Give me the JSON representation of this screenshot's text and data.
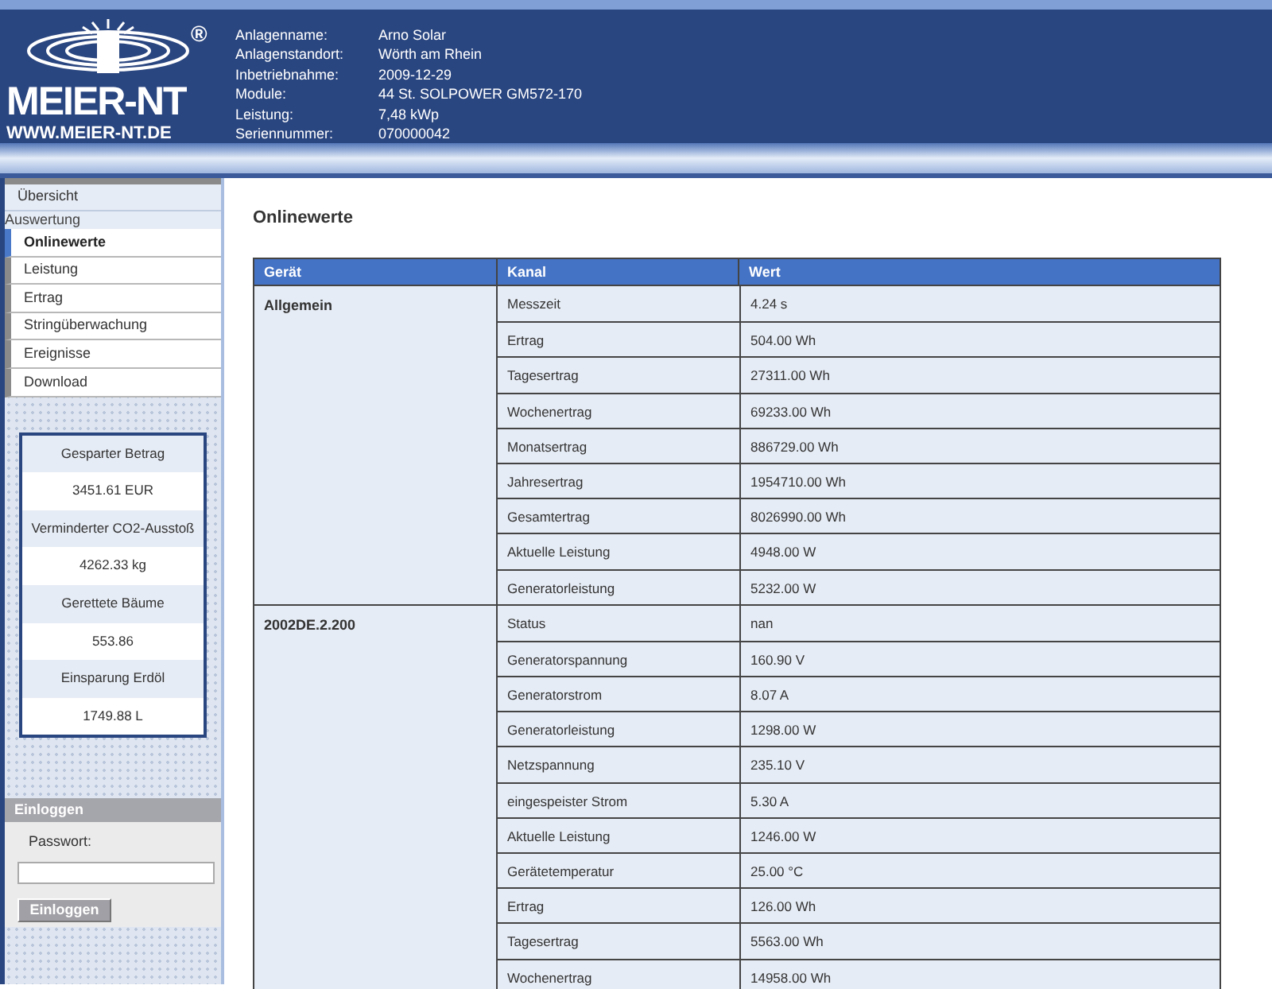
{
  "logo": {
    "wordmark": "MEIER-NT",
    "url": "WWW.MEIER-NT.DE",
    "registered": "®"
  },
  "plant_info": [
    {
      "label": "Anlagenname:",
      "value": "Arno Solar"
    },
    {
      "label": "Anlagenstandort:",
      "value": "Wörth am Rhein"
    },
    {
      "label": "Inbetriebnahme:",
      "value": "2009-12-29"
    },
    {
      "label": "Module:",
      "value": "44 St. SOLPOWER GM572-170"
    },
    {
      "label": "Leistung:",
      "value": "7,48 kWp"
    },
    {
      "label": "Seriennummer:",
      "value": "070000042"
    }
  ],
  "sidebar": {
    "top_item": {
      "label": "Übersicht",
      "selected": false
    },
    "section_label": "Auswertung",
    "items": [
      {
        "label": "Onlinewerte",
        "selected": true
      },
      {
        "label": "Leistung",
        "selected": false
      },
      {
        "label": "Ertrag",
        "selected": false
      },
      {
        "label": "Stringüberwachung",
        "selected": false
      },
      {
        "label": "Ereignisse",
        "selected": false
      },
      {
        "label": "Download",
        "selected": false
      }
    ]
  },
  "savings": [
    {
      "kind": "label",
      "text": "Gesparter Betrag"
    },
    {
      "kind": "value",
      "text": "3451.61 EUR"
    },
    {
      "kind": "label",
      "text": "Verminderter CO2-Ausstoß"
    },
    {
      "kind": "value",
      "text": "4262.33 kg"
    },
    {
      "kind": "label",
      "text": "Gerettete Bäume"
    },
    {
      "kind": "value",
      "text": "553.86"
    },
    {
      "kind": "label",
      "text": "Einsparung Erdöl"
    },
    {
      "kind": "value",
      "text": "1749.88 L"
    }
  ],
  "login": {
    "title": "Einloggen",
    "password_label": "Passwort:",
    "button": "Einloggen"
  },
  "page_title": "Onlinewerte",
  "table": {
    "columns": [
      "Gerät",
      "Kanal",
      "Wert"
    ],
    "groups": [
      {
        "device": "Allgemein",
        "rows": [
          {
            "channel": "Messzeit",
            "value": "4.24 s"
          },
          {
            "channel": "Ertrag",
            "value": "504.00 Wh"
          },
          {
            "channel": "Tagesertrag",
            "value": "27311.00 Wh"
          },
          {
            "channel": "Wochenertrag",
            "value": "69233.00 Wh"
          },
          {
            "channel": "Monatsertrag",
            "value": "886729.00 Wh"
          },
          {
            "channel": "Jahresertrag",
            "value": "1954710.00 Wh"
          },
          {
            "channel": "Gesamtertrag",
            "value": "8026990.00 Wh"
          },
          {
            "channel": "Aktuelle Leistung",
            "value": "4948.00 W"
          },
          {
            "channel": "Generatorleistung",
            "value": "5232.00 W"
          }
        ]
      },
      {
        "device": "2002DE.2.200",
        "rows": [
          {
            "channel": "Status",
            "value": "nan"
          },
          {
            "channel": "Generatorspannung",
            "value": "160.90 V"
          },
          {
            "channel": "Generatorstrom",
            "value": "8.07 A"
          },
          {
            "channel": "Generatorleistung",
            "value": "1298.00 W"
          },
          {
            "channel": "Netzspannung",
            "value": "235.10 V"
          },
          {
            "channel": "eingespeister Strom",
            "value": "5.30 A"
          },
          {
            "channel": "Aktuelle Leistung",
            "value": "1246.00 W"
          },
          {
            "channel": "Gerätetemperatur",
            "value": "25.00 °C"
          },
          {
            "channel": "Ertrag",
            "value": "126.00 Wh"
          },
          {
            "channel": "Tagesertrag",
            "value": "5563.00 Wh"
          },
          {
            "channel": "Wochenertrag",
            "value": "14958.00 Wh"
          }
        ]
      }
    ]
  }
}
